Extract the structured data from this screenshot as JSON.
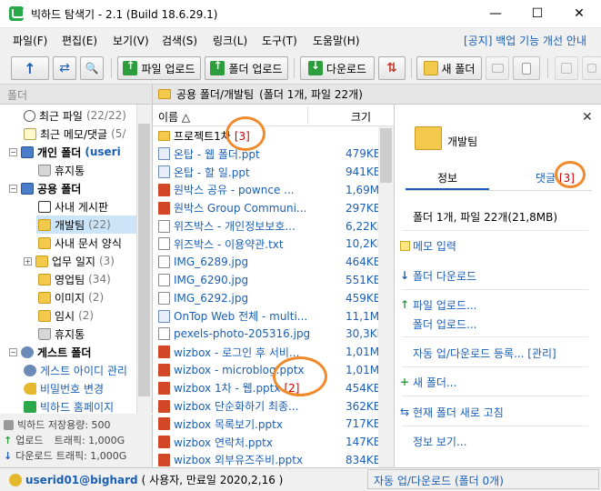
{
  "window": {
    "title": "빅하드 탐색기 - 2.1 (Build 18.6.29.1)",
    "minimize": "—",
    "maximize": "☐",
    "close": "✕"
  },
  "menu": {
    "items": [
      "파일(F)",
      "편집(E)",
      "보기(V)",
      "검색(S)",
      "링크(L)",
      "도구(T)",
      "도움말(H)"
    ],
    "notice": "[공지] 백업 기능 개선 안내"
  },
  "toolbar": {
    "up": "↑",
    "refresh": "⇄",
    "search": "🔍",
    "upload_file": "파일 업로드",
    "upload_folder": "폴더 업로드",
    "download": "다운로드",
    "transfer": "⇅",
    "new_folder": "새 폴더"
  },
  "left_panel": {
    "header": "폴더",
    "tree": [
      {
        "label": "최근 파일",
        "count": "(22/22)"
      },
      {
        "label": "최근 메모/댓글",
        "count": "(5/"
      },
      {
        "label": "개인 폴더",
        "extra": "(useri"
      },
      {
        "label": "휴지통"
      },
      {
        "label": "공용 폴더"
      },
      {
        "label": "사내 게시판"
      },
      {
        "label": "개발팀",
        "count": "(22)"
      },
      {
        "label": "사내 문서 양식"
      },
      {
        "label": "업무 일지",
        "count": "(3)"
      },
      {
        "label": "영업팀",
        "count": "(34)"
      },
      {
        "label": "이미지",
        "count": "(2)"
      },
      {
        "label": "임시",
        "count": "(2)"
      },
      {
        "label": "휴지통"
      },
      {
        "label": "게스트 폴더"
      },
      {
        "label": "게스트 아이디 관리"
      },
      {
        "label": "비밀번호 변경"
      },
      {
        "label": "빅하드 홈페이지"
      }
    ],
    "stats": {
      "storage": "빅하드 저장용량: 500",
      "upload_label": "업로드",
      "upload_value": "트래픽: 1,000G",
      "download_label": "다운로드",
      "download_value": "트래픽: 1,000G"
    }
  },
  "path_bar": {
    "path": "공용 폴더/개발팀",
    "summary": "(폴더 1개, 파일 22개)"
  },
  "file_list": {
    "columns": {
      "name": "이름 △",
      "size": "크기"
    },
    "rows": [
      {
        "name": "프로젝트1차",
        "size": "",
        "type": "folder",
        "badge": "[3]"
      },
      {
        "name": "온탑 - 웹 폴더.ppt",
        "size": "479KB",
        "type": "lnk"
      },
      {
        "name": "온탑 - 할 일.ppt",
        "size": "941KB",
        "type": "lnk"
      },
      {
        "name": "원박스 공유 - pownce ...",
        "size": "1,69MB",
        "type": "ppt"
      },
      {
        "name": "원박스 Group Communi...",
        "size": "297KB",
        "type": "ppt"
      },
      {
        "name": "위즈박스 - 개인정보보호...",
        "size": "6,22KB",
        "type": "txt"
      },
      {
        "name": "위즈박스 - 이용약관.txt",
        "size": "10,2KB",
        "type": "txt"
      },
      {
        "name": "IMG_6289.jpg",
        "size": "464KB",
        "type": "img"
      },
      {
        "name": "IMG_6290.jpg",
        "size": "551KB",
        "type": "img"
      },
      {
        "name": "IMG_6292.jpg",
        "size": "459KB",
        "type": "img"
      },
      {
        "name": "OnTop Web 전체 - multi...",
        "size": "11,1MB",
        "type": "lnk"
      },
      {
        "name": "pexels-photo-205316.jpg",
        "size": "30,3KB",
        "type": "img"
      },
      {
        "name": "wizbox - 로그인 후 서비...",
        "size": "1,01MB",
        "type": "ppt"
      },
      {
        "name": "wizbox - microblog.pptx",
        "size": "1,01MB",
        "type": "ppt"
      },
      {
        "name": "wizbox 1차 - 웹.pptx",
        "size": "454KB",
        "type": "ppt",
        "badge": "[2]"
      },
      {
        "name": "wizbox 단순화하기 최종...",
        "size": "362KB",
        "type": "ppt"
      },
      {
        "name": "wizbox 목록보기.pptx",
        "size": "717KB",
        "type": "ppt"
      },
      {
        "name": "wizbox 연락처.pptx",
        "size": "147KB",
        "type": "ppt"
      },
      {
        "name": "wizbox 외부유즈주비.pptx",
        "size": "834KB",
        "type": "ppt"
      }
    ]
  },
  "detail": {
    "title": "개발팀",
    "tab_info": "정보",
    "tab_comment": "댓글",
    "tab_comment_badge": "[3]",
    "summary": "폴더 1개, 파일 22개(21,8MB)",
    "actions": {
      "memo": "메모 입력",
      "folder_download": "폴더 다운로드",
      "file_upload": "파일 업로드...",
      "folder_upload": "폴더 업로드...",
      "auto_sync": "자동 업/다운로드 등록... [관리]",
      "new_folder": "새 폴더...",
      "refresh": "현재 폴더 새로 고침",
      "info": "정보 보기..."
    }
  },
  "status": {
    "user": "userid01@bighard",
    "user_info": "( 사용자, 만료일 2020,2,16 )",
    "right": "자동 업/다운로드 (폴더 0개)"
  }
}
